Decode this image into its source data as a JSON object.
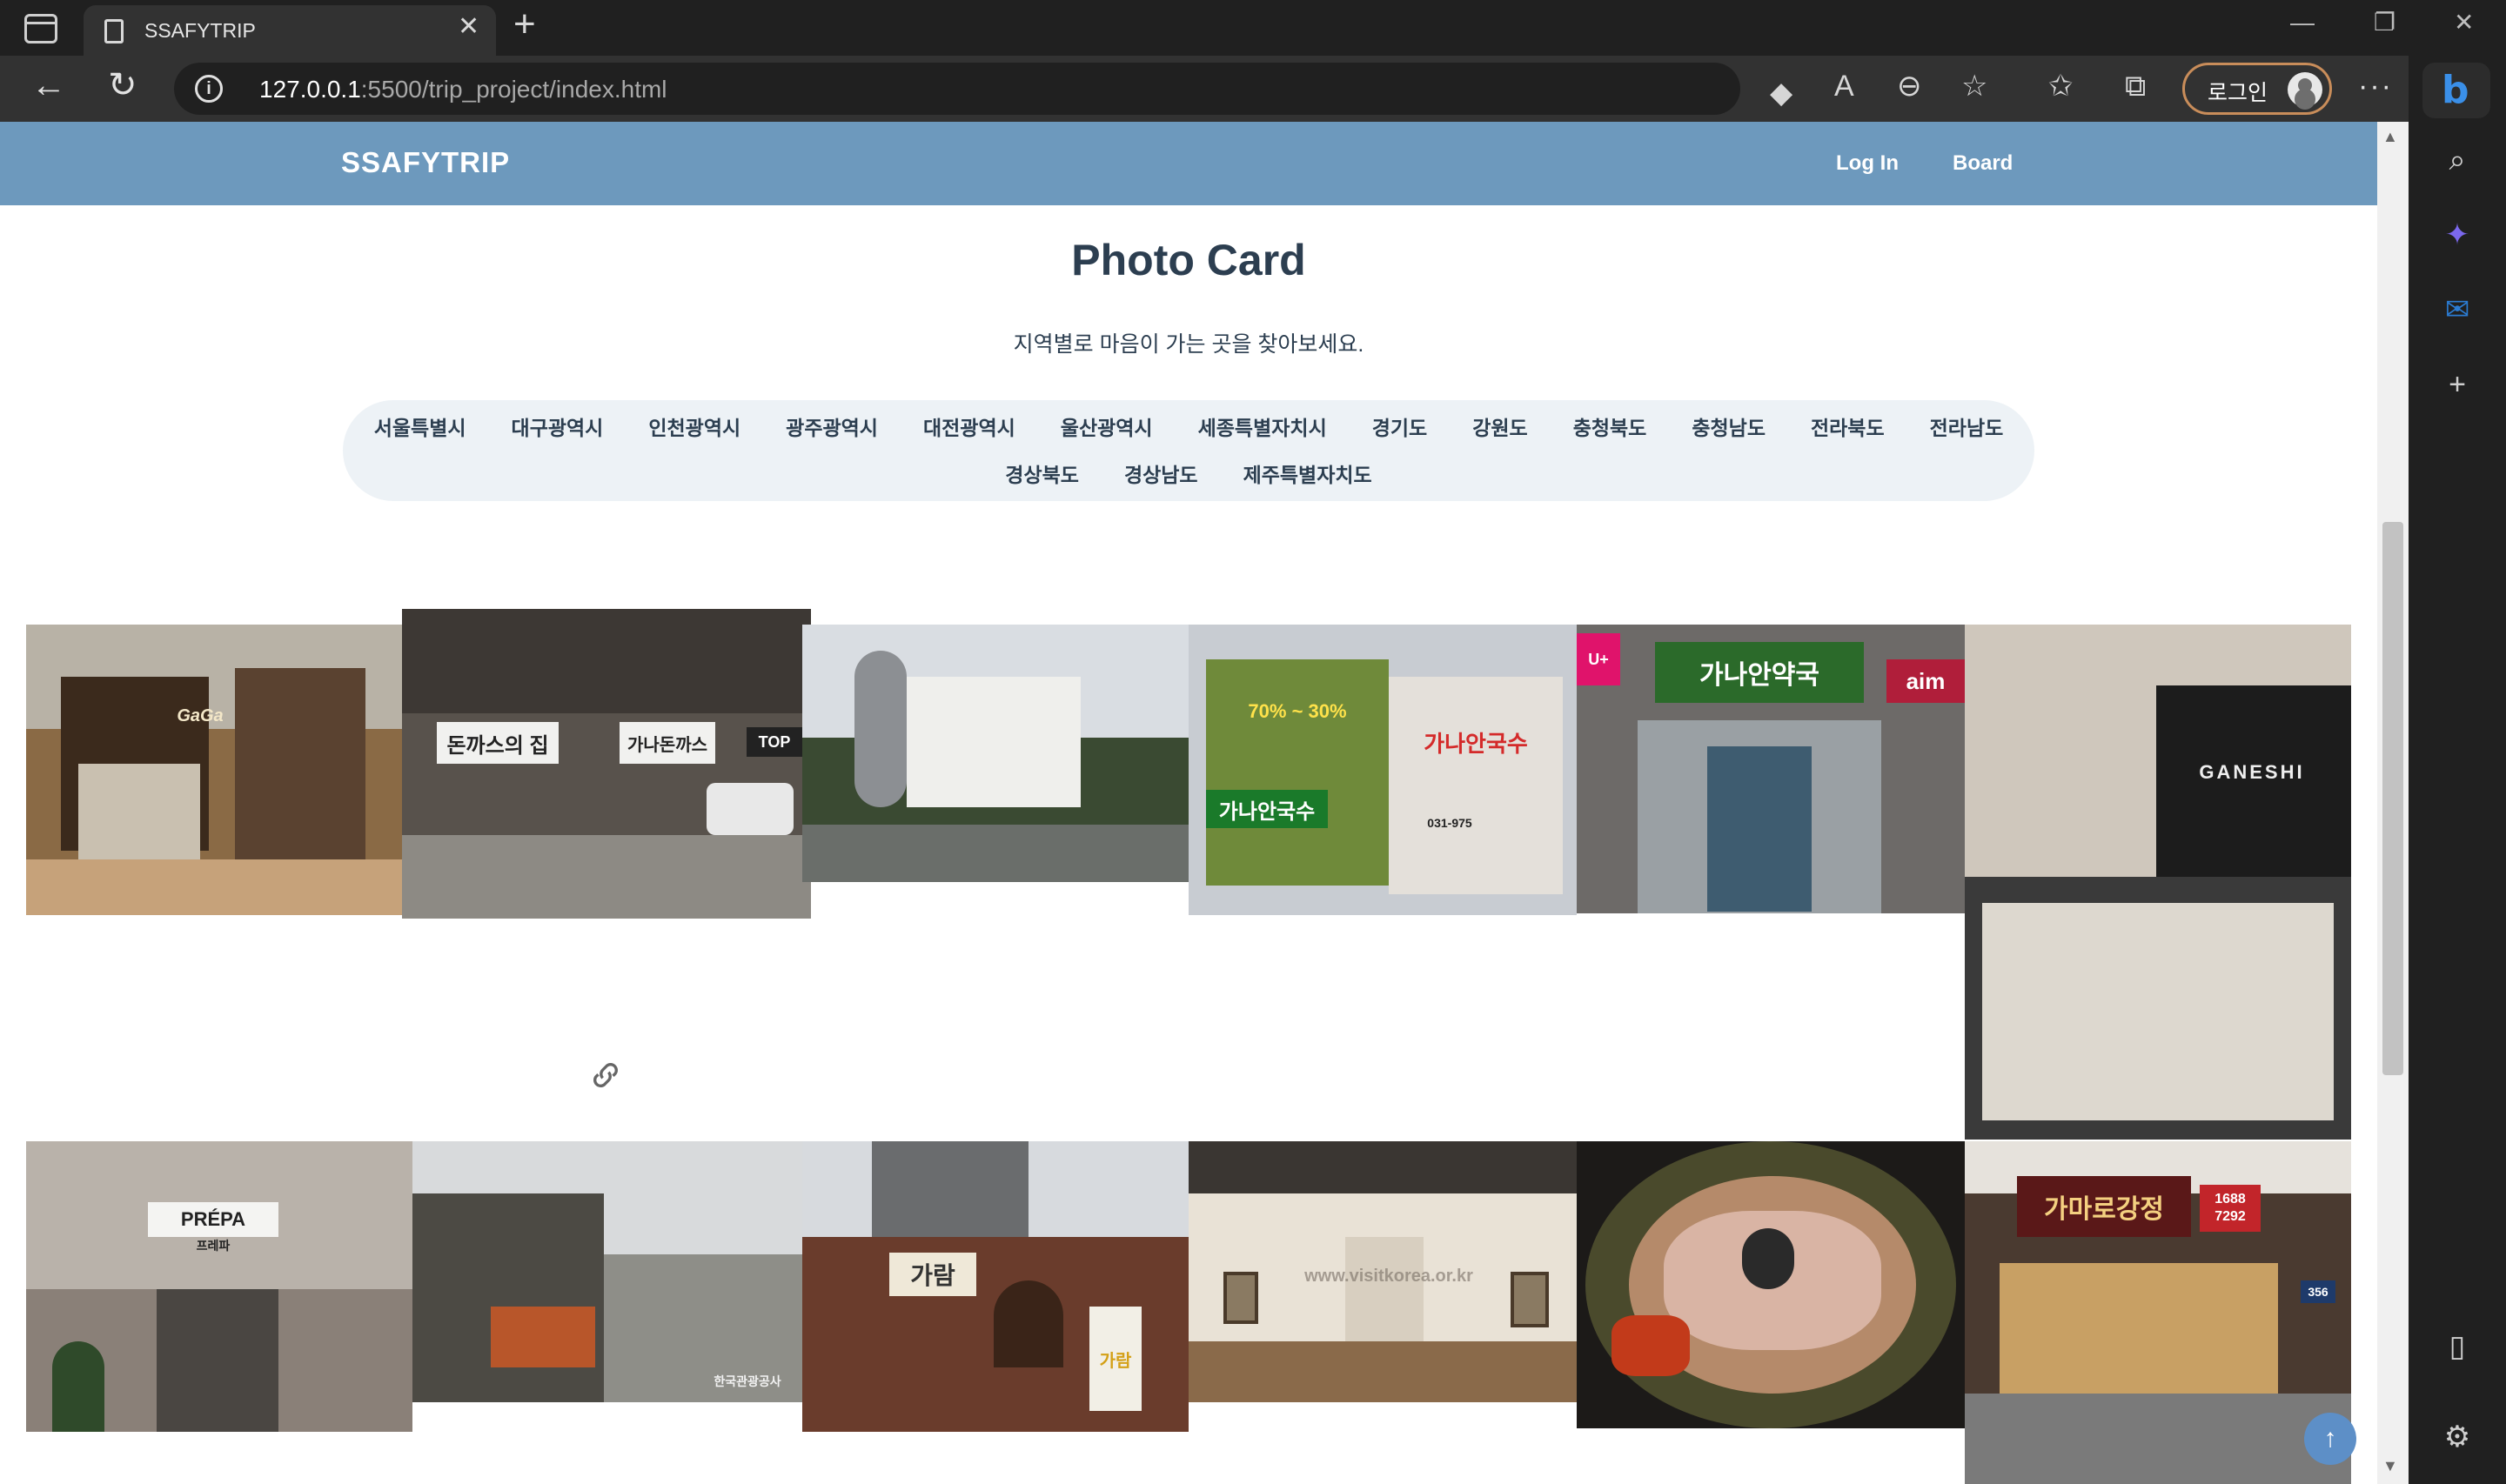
{
  "browser": {
    "tab_title": "SSAFYTRIP",
    "url_host": "127.0.0.1",
    "url_rest": ":5500/trip_project/index.html",
    "profile_label": "로그인"
  },
  "header": {
    "brand": "SSAFYTRIP",
    "nav": [
      "Log In",
      "Board"
    ]
  },
  "main": {
    "title": "Photo Card",
    "subtitle": "지역별로 마음이 가는 곳을 찾아보세요."
  },
  "regions": {
    "row1": [
      "서울특별시",
      "대구광역시",
      "인천광역시",
      "광주광역시",
      "대전광역시",
      "울산광역시",
      "세종특별자치시",
      "경기도",
      "강원도",
      "충청북도",
      "충청남도",
      "전라북도",
      "전라남도"
    ],
    "row2": [
      "경상북도",
      "경상남도",
      "제주특별자치도"
    ]
  },
  "photo_signs": {
    "watch_brand": "GaGa",
    "donkatsu_left": "돈까스의 집",
    "donkatsu_mid": "가나돈까스",
    "donkatsu_right": "TOP",
    "noodle_main": "가나안국수",
    "noodle_price": "70% ~ 30%",
    "noodle_phone": "031-975",
    "pharmacy_name": "가나안약국",
    "pharmacy_left": "U+",
    "pharmacy_right": "aim",
    "ganeshi": "GANESHI",
    "prepa": "PRÉPA",
    "prepa_sub": "프레파",
    "garam": "가람",
    "gallery_watermark": "www.visitkorea.or.kr",
    "restaurant_name": "가마로강정",
    "restaurant_phone": "1688 7292",
    "market_watermark": "한국관광공사",
    "street_num": "356"
  },
  "colors": {
    "header_bg": "#6d99bd",
    "title": "#2c3e50",
    "pill_bg": "#edf2f6",
    "to_top": "#5d8fc7"
  },
  "icons": [
    "sidebar-toggle-icon",
    "page-icon",
    "close-icon",
    "plus-icon",
    "minimize-icon",
    "restore-icon",
    "back-icon",
    "refresh-icon",
    "info-icon",
    "tag-icon",
    "read-aloud-icon",
    "zoom-out-icon",
    "add-favorite-icon",
    "favorites-icon",
    "collections-icon",
    "more-icon",
    "bing-icon",
    "search-icon",
    "copilot-icon",
    "outlook-icon",
    "link-icon",
    "arrow-up-icon",
    "settings-icon"
  ]
}
